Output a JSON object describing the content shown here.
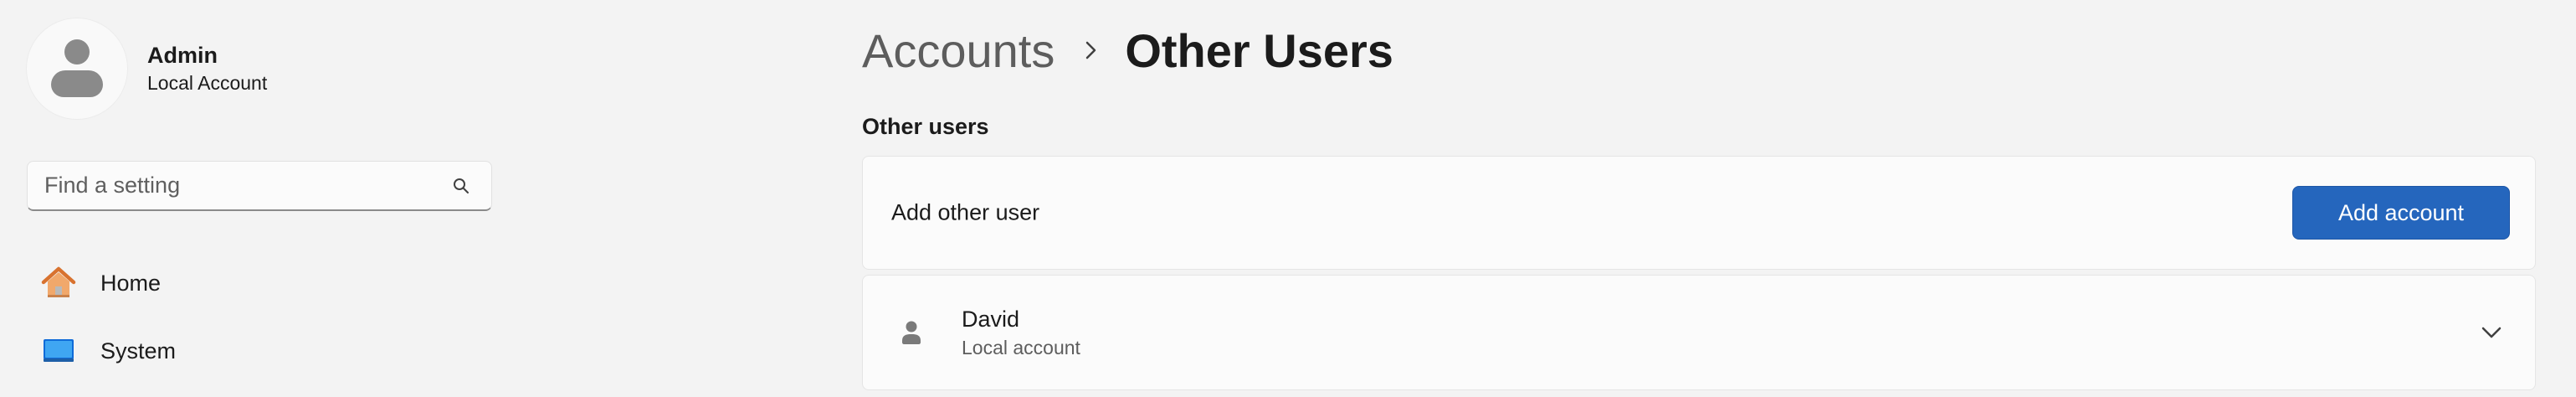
{
  "profile": {
    "name": "Admin",
    "account_type": "Local Account"
  },
  "search": {
    "placeholder": "Find a setting",
    "value": ""
  },
  "nav": [
    {
      "label": "Home",
      "icon": "home-icon"
    },
    {
      "label": "System",
      "icon": "system-icon"
    }
  ],
  "breadcrumb": {
    "parent": "Accounts",
    "separator_icon": "chevron-right-icon",
    "current": "Other Users"
  },
  "section": {
    "title": "Other users"
  },
  "add_user": {
    "label": "Add other user",
    "button_label": "Add account"
  },
  "users": [
    {
      "name": "David",
      "type": "Local account"
    }
  ],
  "colors": {
    "accent": "#2566bd",
    "background": "#f3f3f3",
    "card": "#fbfbfb"
  }
}
